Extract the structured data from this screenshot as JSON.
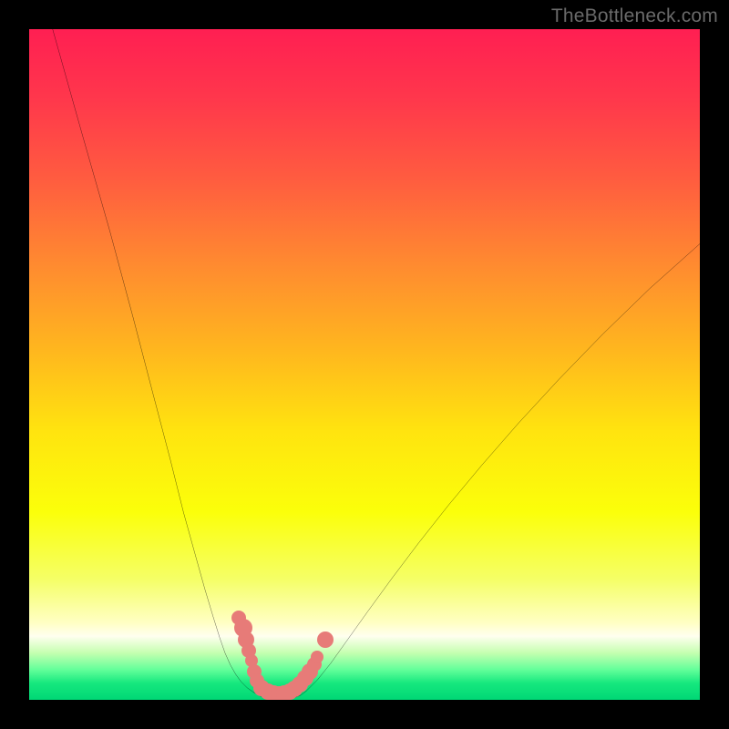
{
  "watermark": {
    "text": "TheBottleneck.com"
  },
  "chart_data": {
    "type": "line",
    "title": "",
    "xlabel": "",
    "ylabel": "",
    "xlim": [
      0,
      100
    ],
    "ylim": [
      0,
      100
    ],
    "grid": false,
    "legend": false,
    "background_gradient": {
      "stops": [
        {
          "pos": 0.0,
          "color": "#ff1f52"
        },
        {
          "pos": 0.1,
          "color": "#ff364c"
        },
        {
          "pos": 0.22,
          "color": "#ff5b40"
        },
        {
          "pos": 0.35,
          "color": "#ff8a30"
        },
        {
          "pos": 0.48,
          "color": "#ffb71e"
        },
        {
          "pos": 0.6,
          "color": "#ffe40f"
        },
        {
          "pos": 0.72,
          "color": "#fbff0a"
        },
        {
          "pos": 0.82,
          "color": "#f5ff66"
        },
        {
          "pos": 0.885,
          "color": "#ffffc4"
        },
        {
          "pos": 0.905,
          "color": "#ffffef"
        },
        {
          "pos": 0.93,
          "color": "#c5ffb0"
        },
        {
          "pos": 0.955,
          "color": "#63ff9a"
        },
        {
          "pos": 0.975,
          "color": "#16e87e"
        },
        {
          "pos": 1.0,
          "color": "#00d775"
        }
      ]
    },
    "series": [
      {
        "name": "left-curve",
        "type": "line",
        "color": "#000000",
        "width": 2.2,
        "x": [
          3.5,
          8.0,
          12.0,
          15.5,
          18.5,
          21.0,
          23.0,
          24.8,
          26.2,
          27.4,
          28.4,
          29.2,
          30.0,
          30.8,
          31.6,
          32.5,
          33.5
        ],
        "y": [
          100.0,
          84.0,
          70.0,
          57.0,
          45.5,
          36.0,
          28.0,
          21.5,
          16.5,
          12.5,
          9.3,
          7.0,
          5.2,
          3.8,
          2.7,
          1.8,
          1.1
        ]
      },
      {
        "name": "basin",
        "type": "line",
        "color": "#000000",
        "width": 2.2,
        "x": [
          33.5,
          34.5,
          35.5,
          36.5,
          37.5,
          38.5,
          39.5,
          40.5,
          41.3
        ],
        "y": [
          1.1,
          0.55,
          0.25,
          0.1,
          0.05,
          0.1,
          0.3,
          0.7,
          1.3
        ]
      },
      {
        "name": "right-curve",
        "type": "line",
        "color": "#000000",
        "width": 2.2,
        "x": [
          41.3,
          43.0,
          45.0,
          47.5,
          50.5,
          54.0,
          58.0,
          62.5,
          67.5,
          73.0,
          79.0,
          85.5,
          92.5,
          100.0
        ],
        "y": [
          1.3,
          3.0,
          5.5,
          9.0,
          13.2,
          18.0,
          23.3,
          29.0,
          35.0,
          41.3,
          47.8,
          54.5,
          61.3,
          68.0
        ]
      }
    ],
    "markers": {
      "name": "bottleneck-points",
      "color": "#e77b78",
      "points": [
        {
          "x": 31.3,
          "y": 12.2,
          "r": 8
        },
        {
          "x": 31.9,
          "y": 10.7,
          "r": 10
        },
        {
          "x": 32.4,
          "y": 9.0,
          "r": 9
        },
        {
          "x": 32.8,
          "y": 7.4,
          "r": 8
        },
        {
          "x": 33.1,
          "y": 5.9,
          "r": 7
        },
        {
          "x": 33.5,
          "y": 4.2,
          "r": 8
        },
        {
          "x": 34.0,
          "y": 2.8,
          "r": 8
        },
        {
          "x": 34.7,
          "y": 1.8,
          "r": 9
        },
        {
          "x": 35.6,
          "y": 1.2,
          "r": 9
        },
        {
          "x": 36.4,
          "y": 0.9,
          "r": 9
        },
        {
          "x": 37.2,
          "y": 0.8,
          "r": 9
        },
        {
          "x": 38.0,
          "y": 0.9,
          "r": 9
        },
        {
          "x": 38.8,
          "y": 1.2,
          "r": 9
        },
        {
          "x": 39.6,
          "y": 1.6,
          "r": 9
        },
        {
          "x": 40.4,
          "y": 2.3,
          "r": 9
        },
        {
          "x": 41.2,
          "y": 3.2,
          "r": 9
        },
        {
          "x": 41.9,
          "y": 4.2,
          "r": 9
        },
        {
          "x": 42.5,
          "y": 5.3,
          "r": 8
        },
        {
          "x": 43.0,
          "y": 6.4,
          "r": 7
        },
        {
          "x": 44.1,
          "y": 9.0,
          "r": 9
        }
      ]
    }
  }
}
